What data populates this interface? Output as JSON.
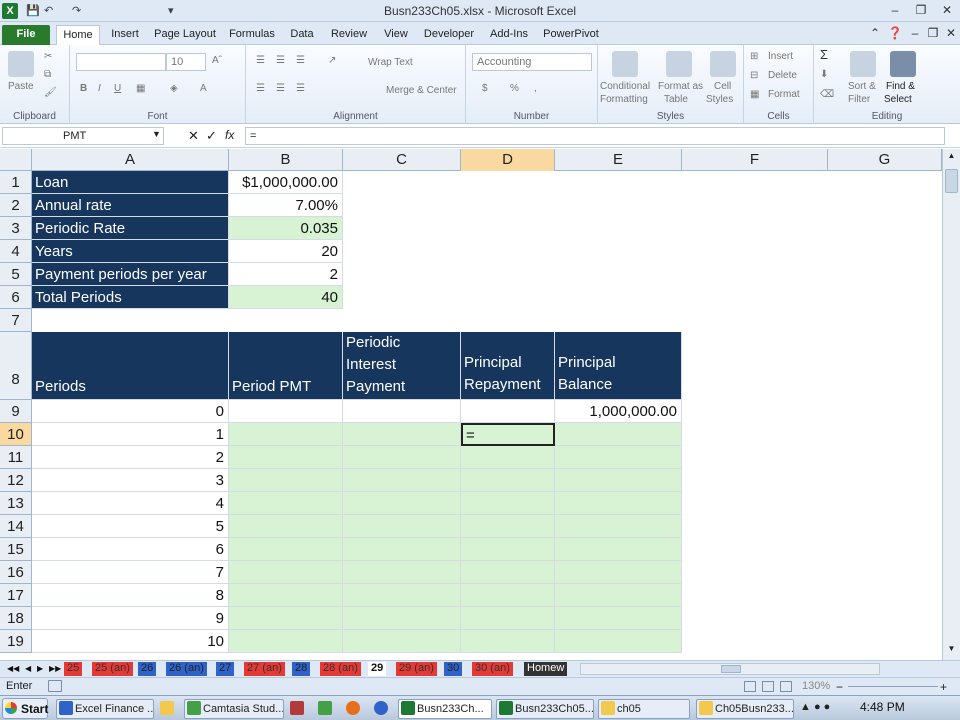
{
  "window": {
    "title": "Busn233Ch05.xlsx - Microsoft Excel"
  },
  "ribbon_tabs": [
    "File",
    "Home",
    "Insert",
    "Page Layout",
    "Formulas",
    "Data",
    "Review",
    "View",
    "Developer",
    "Add-Ins",
    "PowerPivot"
  ],
  "active_tab": "Home",
  "ribbon": {
    "clipboard": {
      "label": "Clipboard",
      "paste": "Paste"
    },
    "font": {
      "label": "Font",
      "font_size": "10"
    },
    "alignment": {
      "label": "Alignment",
      "wrap_text": "Wrap Text",
      "merge_center": "Merge & Center"
    },
    "number": {
      "label": "Number",
      "format": "Accounting",
      "currency_symbol": "$",
      "percent_symbol": "%"
    },
    "styles": {
      "label": "Styles",
      "conditional_1": "Conditional",
      "conditional_2": "Formatting",
      "format_as_1": "Format as",
      "format_as_2": "Table",
      "cell_styles_1": "Cell",
      "cell_styles_2": "Styles"
    },
    "cells": {
      "label": "Cells",
      "insert": "Insert",
      "delete": "Delete",
      "format": "Format"
    },
    "editing": {
      "label": "Editing",
      "sort_1": "Sort &",
      "sort_2": "Filter",
      "find_1": "Find &",
      "find_2": "Select"
    }
  },
  "formula_bar": {
    "name_box": "PMT",
    "fx": "fx",
    "formula": "="
  },
  "columns": [
    "A",
    "B",
    "C",
    "D",
    "E",
    "F",
    "G"
  ],
  "rows": {
    "r1": {
      "num": "1",
      "a": "Loan",
      "b": "$1,000,000.00"
    },
    "r2": {
      "num": "2",
      "a": "Annual rate",
      "b": "7.00%"
    },
    "r3": {
      "num": "3",
      "a": "Periodic Rate",
      "b": "0.035"
    },
    "r4": {
      "num": "4",
      "a": "Years",
      "b": "20"
    },
    "r5": {
      "num": "5",
      "a": "Payment periods per year",
      "b": "2"
    },
    "r6": {
      "num": "6",
      "a": "Total Periods",
      "b": "40"
    },
    "r7": {
      "num": "7"
    },
    "r8": {
      "num": "8",
      "a": "Periods",
      "b": "Period PMT",
      "c": "Periodic Interest Payment",
      "d": "Principal Repayment",
      "e": "Principal Balance"
    },
    "r9": {
      "num": "9",
      "a": "0",
      "e": "1,000,000.00"
    },
    "r10": {
      "num": "10",
      "a": "1",
      "d": "="
    },
    "r11": {
      "num": "11",
      "a": "2"
    },
    "r12": {
      "num": "12",
      "a": "3"
    },
    "r13": {
      "num": "13",
      "a": "4"
    },
    "r14": {
      "num": "14",
      "a": "5"
    },
    "r15": {
      "num": "15",
      "a": "6"
    },
    "r16": {
      "num": "16",
      "a": "7"
    },
    "r17": {
      "num": "17",
      "a": "8"
    },
    "r18": {
      "num": "18",
      "a": "9"
    },
    "r19": {
      "num": "19",
      "a": "10"
    }
  },
  "sheet_tabs": [
    "25",
    "25 (an)",
    "26",
    "26 (an)",
    "27",
    "27 (an)",
    "28",
    "28 (an)",
    "29",
    "29 (an)",
    "30",
    "30 (an)",
    "Homew"
  ],
  "active_sheet": "29",
  "status": {
    "mode": "Enter",
    "zoom": "130%"
  },
  "taskbar": {
    "start": "Start",
    "items": [
      "Excel Finance ...",
      "Camtasia Stud...",
      "Busn233Ch...",
      "Busn233Ch05...",
      "ch05",
      "Ch05Busn233..."
    ],
    "clock": "4:48 PM"
  },
  "colors": {
    "navy": "#17365d",
    "green_fill": "#d8f2d4",
    "file_tab": "#2a7a2e"
  }
}
